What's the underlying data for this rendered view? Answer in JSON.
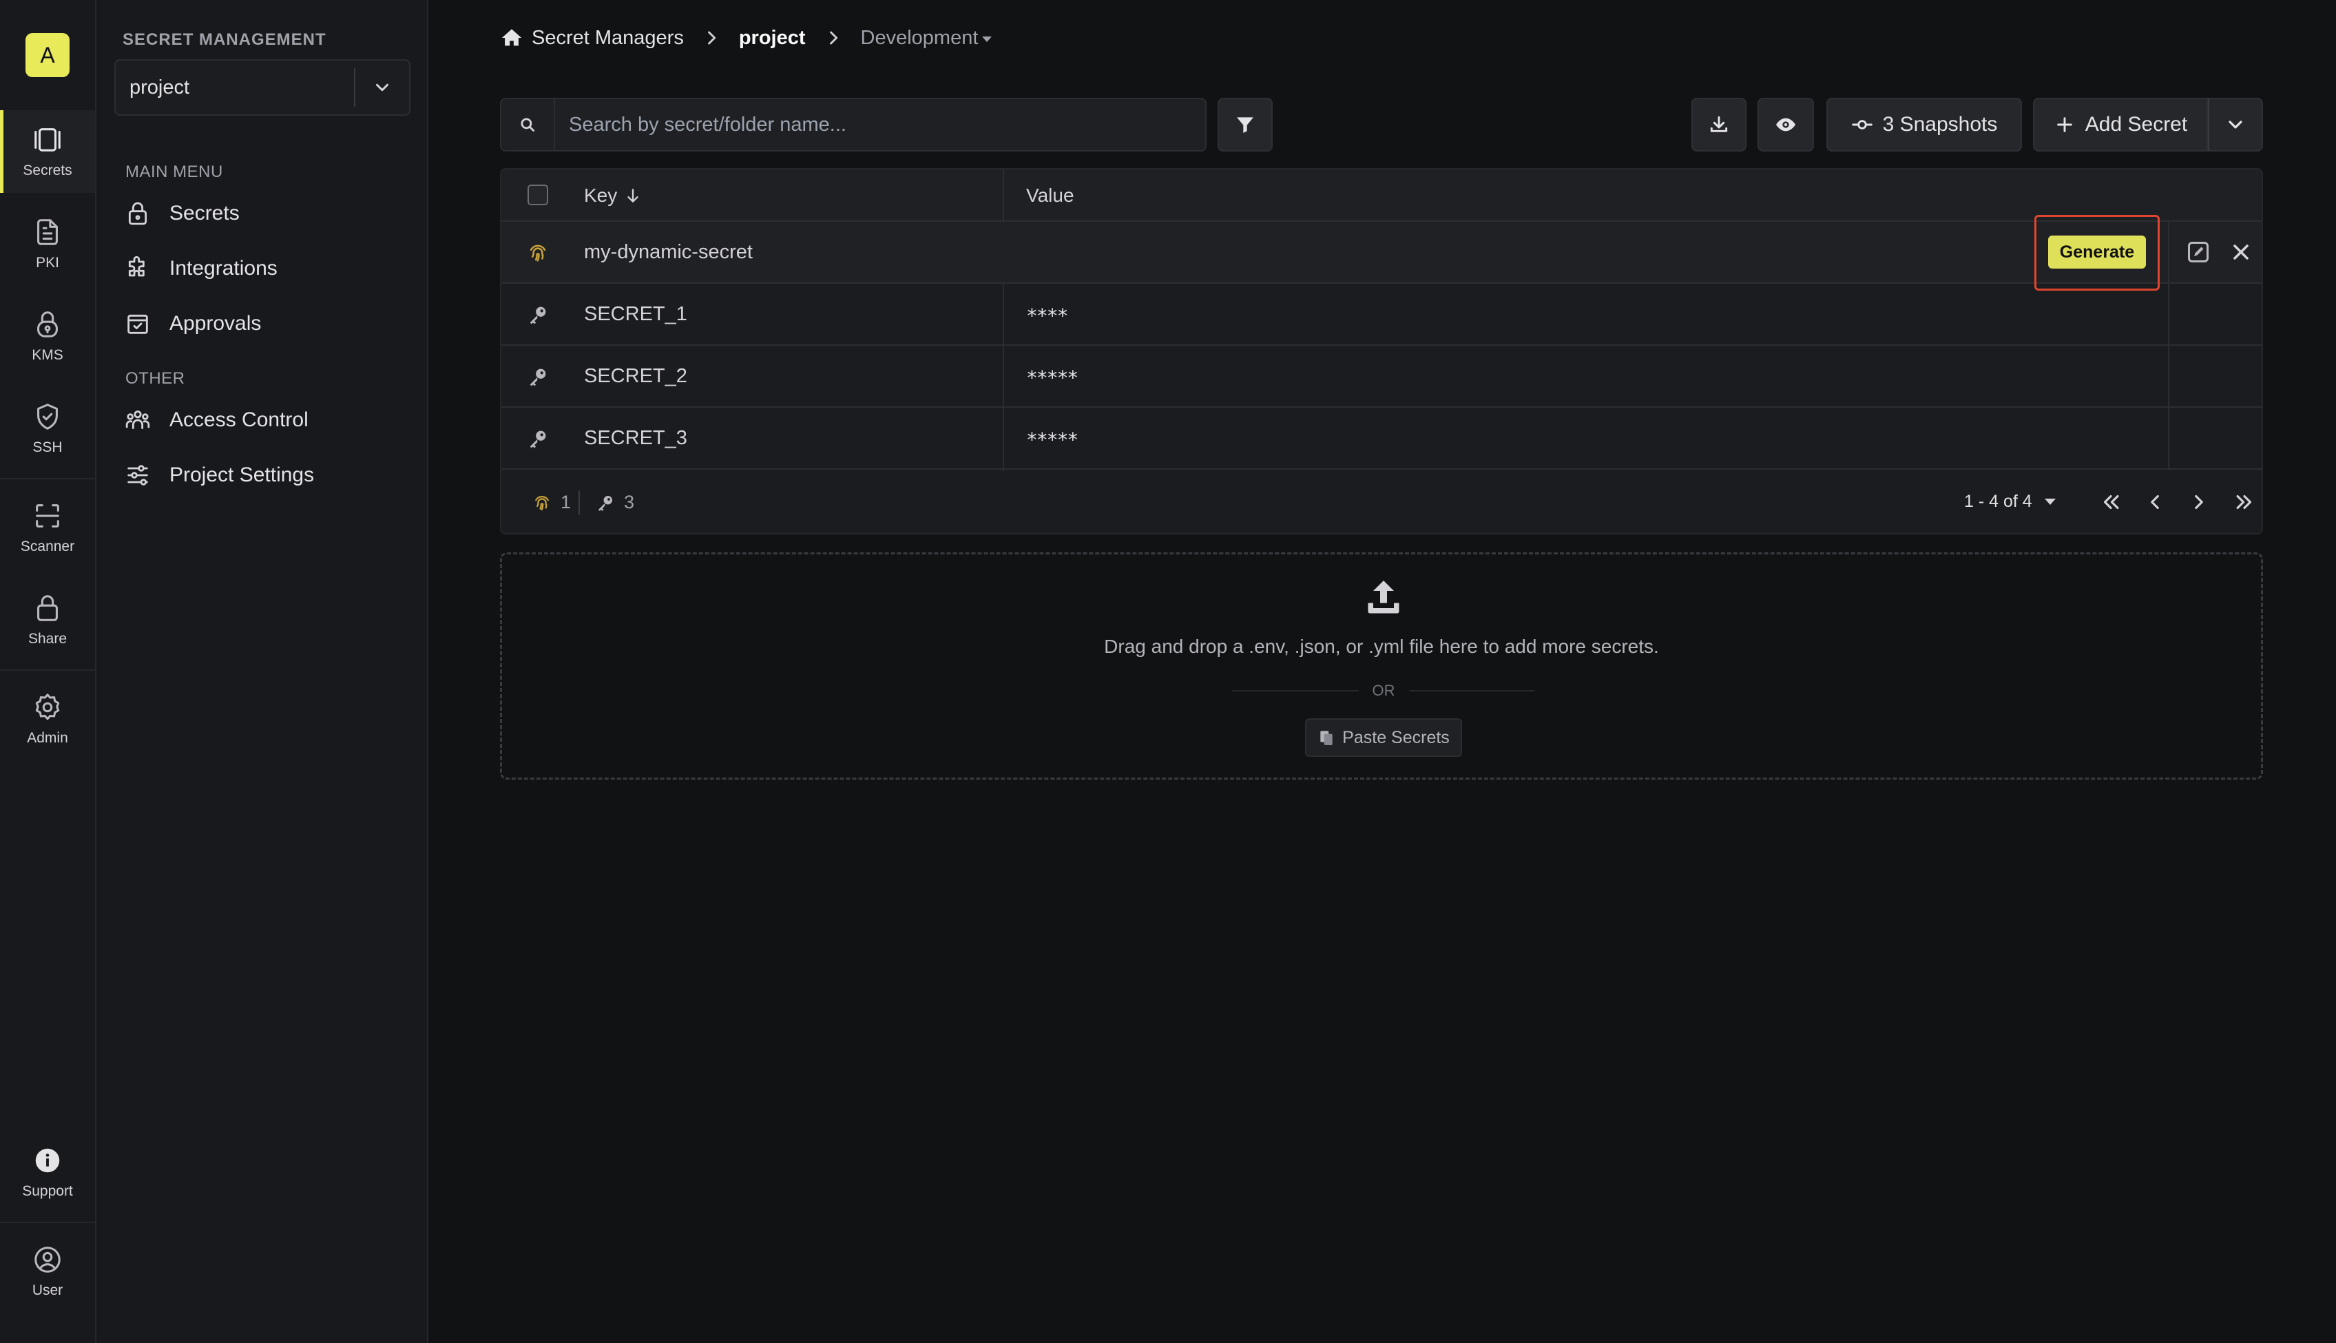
{
  "rail": {
    "org_initial": "A",
    "items": [
      {
        "label": "Secrets",
        "icon": "secrets-icon"
      },
      {
        "label": "PKI",
        "icon": "document-icon"
      },
      {
        "label": "KMS",
        "icon": "lock-icon"
      },
      {
        "label": "SSH",
        "icon": "shield-icon"
      },
      {
        "label": "Scanner",
        "icon": "scan-icon"
      },
      {
        "label": "Share",
        "icon": "lock-icon"
      },
      {
        "label": "Admin",
        "icon": "gear-icon"
      },
      {
        "label": "Support",
        "icon": "info-icon"
      },
      {
        "label": "User",
        "icon": "user-circle-icon"
      }
    ]
  },
  "sidebar": {
    "heading": "SECRET MANAGEMENT",
    "project_value": "project",
    "main_menu_label": "MAIN MENU",
    "main_items": [
      {
        "label": "Secrets",
        "icon": "lock-icon"
      },
      {
        "label": "Integrations",
        "icon": "puzzle-icon"
      },
      {
        "label": "Approvals",
        "icon": "calendar-check-icon"
      }
    ],
    "other_label": "OTHER",
    "other_items": [
      {
        "label": "Access Control",
        "icon": "users-icon"
      },
      {
        "label": "Project Settings",
        "icon": "sliders-icon"
      }
    ]
  },
  "breadcrumb": {
    "root": "Secret Managers",
    "project": "project",
    "environment": "Development"
  },
  "toolbar": {
    "search_placeholder": "Search by secret/folder name...",
    "snapshots_label": "3 Snapshots",
    "add_secret_label": "Add Secret"
  },
  "table": {
    "col_key": "Key",
    "col_value": "Value",
    "rows": [
      {
        "key": "my-dynamic-secret",
        "value": "",
        "type": "dynamic"
      },
      {
        "key": "SECRET_1",
        "value": "****",
        "type": "static"
      },
      {
        "key": "SECRET_2",
        "value": "*****",
        "type": "static"
      },
      {
        "key": "SECRET_3",
        "value": "*****",
        "type": "static"
      }
    ],
    "generate_label": "Generate",
    "footer": {
      "dynamic_count": "1",
      "static_count": "3",
      "range": "1 - 4 of 4"
    }
  },
  "dropzone": {
    "text": "Drag and drop a .env, .json, or .yml file here to add more secrets.",
    "or": "OR",
    "paste_label": "Paste Secrets"
  },
  "colors": {
    "accent": "#e8ea5a",
    "highlight_frame": "#e0452f",
    "dynamic_icon": "#c8a23a",
    "background": "#111214"
  }
}
